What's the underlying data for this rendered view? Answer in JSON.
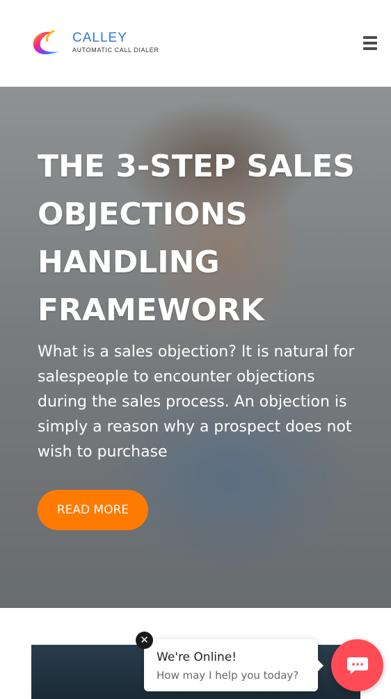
{
  "header": {
    "logo_name": "CALLEY",
    "logo_tagline": "AUTOMATIC CALL DIALER",
    "menu_icon": "hamburger-menu-icon"
  },
  "hero": {
    "title": "THE 3-STEP SALES OBJECTIONS HANDLING FRAMEWORK",
    "text": "What is a sales objection? It is natural for salespeople to encounter objections during the sales process. An objection is simply a reason why a prospect does not wish to purchase",
    "button_label": "READ MORE",
    "button_color": "#ff7a00"
  },
  "chat": {
    "title": "We're Online!",
    "subtitle": "How may I help you today?",
    "close_glyph": "✕",
    "launcher_color": "#ff4b55",
    "launcher_icon": "chat-bubble-icon"
  }
}
